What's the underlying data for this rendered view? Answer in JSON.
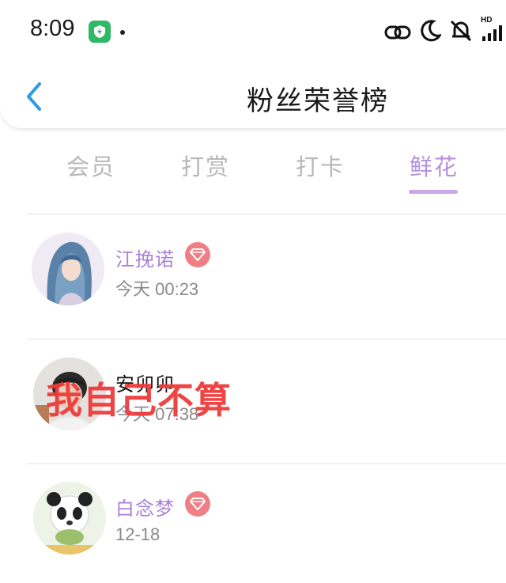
{
  "status_bar": {
    "time": "8:09",
    "hd_label": "HD",
    "icons": [
      "shield-app-icon",
      "link-icon",
      "moon-icon",
      "mute-bell-icon",
      "signal-icon"
    ]
  },
  "header": {
    "title": "粉丝荣誉榜",
    "back_icon": "chevron-left-icon",
    "accent": "#2f9be4"
  },
  "tabs": [
    {
      "label": "会员",
      "active": false
    },
    {
      "label": "打赏",
      "active": false
    },
    {
      "label": "打卡",
      "active": false
    },
    {
      "label": "鲜花",
      "active": true
    }
  ],
  "colors": {
    "tab_active": "#b491dc",
    "tab_inactive": "#b7b7b7",
    "vip_name": "#a981d6",
    "badge": "#f07f85",
    "overlay": "#ef3b3b"
  },
  "fans": [
    {
      "name": "江挽诺",
      "time": "今天 00:23",
      "vip": true
    },
    {
      "name": "安卯卯",
      "time": "今天 07:38",
      "vip": false
    },
    {
      "name": "白念梦",
      "time": "12-18",
      "vip": true
    }
  ],
  "overlay_text": "我自己不算"
}
